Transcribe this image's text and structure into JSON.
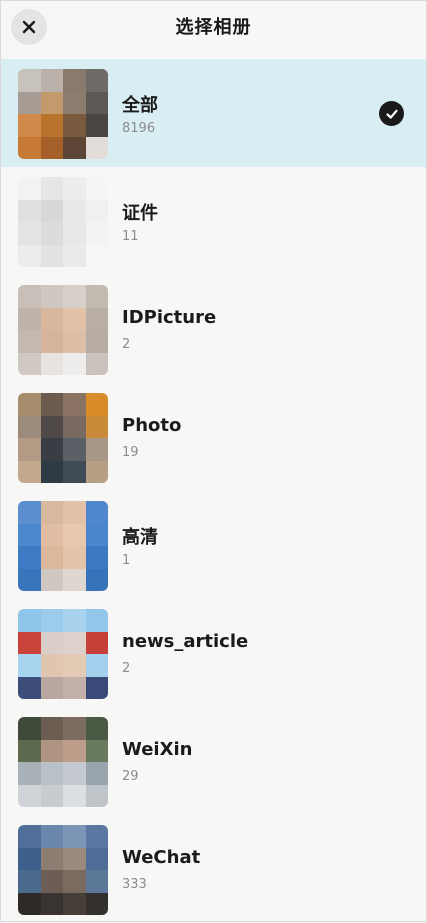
{
  "header": {
    "title": "选择相册",
    "close_icon": "close-icon"
  },
  "albums": [
    {
      "name": "全部",
      "count": "8196",
      "selected": true,
      "thumb_colors": [
        "#c8c2bc",
        "#b9b1aa",
        "#8a7a6e",
        "#6f6a66",
        "#a79c94",
        "#c39a6b",
        "#8c7c6e",
        "#5e5854",
        "#d0894a",
        "#b8742d",
        "#7a5a3e",
        "#4a4542",
        "#c67a33",
        "#a5602a",
        "#5d4636",
        "#e2ddd8"
      ]
    },
    {
      "name": "证件",
      "count": "11",
      "selected": false,
      "thumb_colors": [
        "#f2f2f2",
        "#e6e6e6",
        "#ededed",
        "#f5f5f5",
        "#e0e0e0",
        "#d8d8d8",
        "#e9e9e9",
        "#f0f0f0",
        "#e4e4e4",
        "#dcdcdc",
        "#e8e8e8",
        "#f3f3f3",
        "#ececec",
        "#e2e2e2",
        "#eaeaea",
        "#f6f6f6"
      ]
    },
    {
      "name": "IDPicture",
      "count": "2",
      "selected": false,
      "thumb_colors": [
        "#c7bfb8",
        "#cfc6bf",
        "#d7cfc8",
        "#c2b9b1",
        "#bfb3aa",
        "#d9b79d",
        "#e2c3aa",
        "#b9aea6",
        "#c4b9b1",
        "#d6b49b",
        "#ddbfa7",
        "#b7aca4",
        "#cfc8c3",
        "#e6e3e1",
        "#efedeb",
        "#c9c2bd"
      ]
    },
    {
      "name": "Photo",
      "count": "19",
      "selected": false,
      "thumb_colors": [
        "#a58d6e",
        "#6c5b4f",
        "#8a7363",
        "#d98b2a",
        "#9c8a7a",
        "#4f4a48",
        "#786a60",
        "#c98a3a",
        "#b39a84",
        "#3a3d44",
        "#5b5f66",
        "#a89686",
        "#c2a98e",
        "#2e3a44",
        "#3f4b55",
        "#b79f86"
      ]
    },
    {
      "name": "高清",
      "count": "1",
      "selected": false,
      "thumb_colors": [
        "#5b8fd0",
        "#d9b8a0",
        "#e3c2a8",
        "#4f86cc",
        "#4c87cf",
        "#e0bda3",
        "#e8c8ae",
        "#4a85cd",
        "#3f7bc4",
        "#dcb79c",
        "#e5c4aa",
        "#3d79c2",
        "#3a74bd",
        "#cfc7c2",
        "#ddd6d1",
        "#3872bb"
      ]
    },
    {
      "name": "news_article",
      "count": "2",
      "selected": false,
      "thumb_colors": [
        "#8ec5ea",
        "#9ccbec",
        "#a8d2ee",
        "#92c7eb",
        "#c9433b",
        "#d9cfc8",
        "#dcd2cb",
        "#c64039",
        "#a9d4ef",
        "#e0c6b0",
        "#e3cab5",
        "#a4d0ee",
        "#3c4d7a",
        "#b9a6a0",
        "#c3b0a9",
        "#3a4a78"
      ]
    },
    {
      "name": "WeiXin",
      "count": "29",
      "selected": false,
      "thumb_colors": [
        "#3f4a3a",
        "#6b5d52",
        "#7c6c60",
        "#4a5a44",
        "#5d6a4f",
        "#b09482",
        "#bd9e8a",
        "#6a7a5c",
        "#a8b0b8",
        "#b8c0c8",
        "#c4cad0",
        "#9aa4ad",
        "#d0d4d8",
        "#c8ccd0",
        "#dcdfe2",
        "#bfc4c9"
      ]
    },
    {
      "name": "WeChat",
      "count": "333",
      "selected": false,
      "thumb_colors": [
        "#4f6f9a",
        "#6a86ab",
        "#7d95b6",
        "#5a78a2",
        "#3d5f8c",
        "#8d7d72",
        "#9a897d",
        "#4e6d96",
        "#4a6a8e",
        "#6d5e55",
        "#7a6a60",
        "#5b7899",
        "#2e2a28",
        "#3a3430",
        "#463f3a",
        "#33302d"
      ]
    }
  ]
}
